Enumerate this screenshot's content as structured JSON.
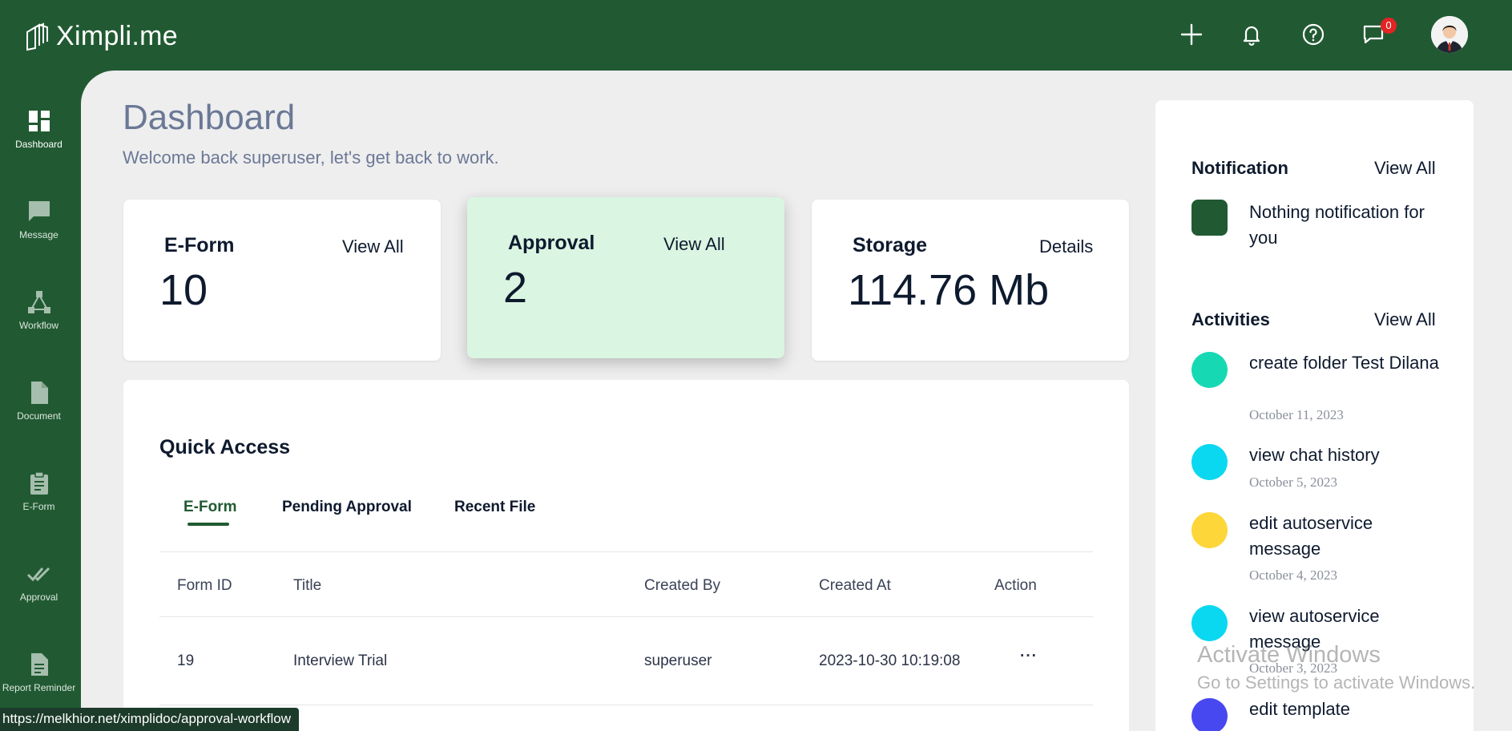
{
  "app": {
    "logo_text": "Ximpli",
    "logo_suffix": ".me"
  },
  "topbar": {
    "message_badge": "0"
  },
  "sidebar": {
    "items": [
      {
        "label": "Dashboard",
        "icon": "dashboard-icon"
      },
      {
        "label": "Message",
        "icon": "message-icon"
      },
      {
        "label": "Workflow",
        "icon": "workflow-icon"
      },
      {
        "label": "Document",
        "icon": "document-icon"
      },
      {
        "label": "E-Form",
        "icon": "clipboard-icon"
      },
      {
        "label": "Approval",
        "icon": "double-check-icon"
      },
      {
        "label": "Report Reminder",
        "icon": "report-icon"
      }
    ]
  },
  "page": {
    "title": "Dashboard",
    "welcome": "Welcome back superuser, let's get back to work."
  },
  "cards": {
    "eform": {
      "title": "E-Form",
      "link": "View All",
      "value": "10"
    },
    "approval": {
      "title": "Approval",
      "link": "View All",
      "value": "2"
    },
    "storage": {
      "title": "Storage",
      "link": "Details",
      "value": "114.76 Mb"
    }
  },
  "quick_access": {
    "title": "Quick Access",
    "tabs": [
      "E-Form",
      "Pending Approval",
      "Recent File"
    ],
    "columns": [
      "Form ID",
      "Title",
      "Created By",
      "Created At",
      "Action"
    ],
    "rows": [
      {
        "form_id": "19",
        "title": "Interview Trial",
        "created_by": "superuser",
        "created_at": "2023-10-30 10:19:08",
        "action": "···"
      }
    ]
  },
  "notification": {
    "title": "Notification",
    "link": "View All",
    "message": "Nothing notification for you"
  },
  "activities": {
    "title": "Activities",
    "link": "View All",
    "items": [
      {
        "text": "create folder Test Dilana",
        "date": "October 11, 2023",
        "color": "#16d9b4"
      },
      {
        "text": "view chat history",
        "date": "October 5, 2023",
        "color": "#0ad8f0"
      },
      {
        "text": "edit autoservice message",
        "date": "October 4, 2023",
        "color": "#fdd63a"
      },
      {
        "text": "view autoservice message",
        "date": "October 3, 2023",
        "color": "#0ad8f0"
      },
      {
        "text": "edit template",
        "date": "",
        "color": "#4848f0"
      }
    ]
  },
  "overlay": {
    "watermark_title": "Activate Windows",
    "watermark_sub": "Go to Settings to activate Windows.",
    "status_url": "https://melkhior.net/ximplidoc/approval-workflow"
  },
  "colors": {
    "brand": "#215a32",
    "approval_card": "#daf5e1",
    "badge": "#e32424"
  }
}
